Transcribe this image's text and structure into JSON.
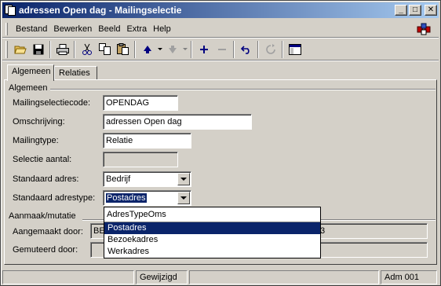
{
  "window": {
    "title": "adressen Open dag - Mailingselectie",
    "min_label": "_",
    "max_label": "□",
    "close_label": "✕"
  },
  "menu": {
    "items": [
      {
        "label": "Bestand"
      },
      {
        "label": "Bewerken"
      },
      {
        "label": "Beeld"
      },
      {
        "label": "Extra"
      },
      {
        "label": "Help"
      }
    ]
  },
  "toolbar": {
    "buttons": [
      {
        "icon": "open-folder-icon"
      },
      {
        "icon": "save-icon"
      },
      {
        "icon": "print-icon"
      },
      {
        "icon": "cut-icon"
      },
      {
        "icon": "copy-icon"
      },
      {
        "icon": "paste-icon"
      },
      {
        "icon": "arrow-up-icon"
      },
      {
        "icon": "arrow-down-icon"
      },
      {
        "icon": "add-icon"
      },
      {
        "icon": "remove-icon"
      },
      {
        "icon": "undo-icon"
      },
      {
        "icon": "refresh-icon"
      },
      {
        "icon": "window-icon"
      }
    ]
  },
  "tabs": [
    {
      "label": "Algemeen",
      "active": true
    },
    {
      "label": "Relaties",
      "active": false
    }
  ],
  "form": {
    "group_general": "Algemeen",
    "code_label": "Mailingselectiecode:",
    "code_value": "OPENDAG",
    "description_label": "Omschrijving:",
    "description_value": "adressen Open dag",
    "type_label": "Mailingtype:",
    "type_value": "Relatie",
    "count_label": "Selectie aantal:",
    "count_value": "",
    "std_address_label": "Standaard adres:",
    "std_address_value": "Bedrijf",
    "std_addresstype_label": "Standaard adrestype:",
    "std_addresstype_value": "Postadres",
    "group_audit": "Aanmaak/mutatie",
    "created_label": "Aangemaakt door:",
    "created_value_prefix": "BE",
    "created_value_suffix": "3",
    "modified_label": "Gemuteerd door:"
  },
  "dropdown": {
    "header": "AdresTypeOms",
    "options": [
      "Postadres",
      "Bezoekadres",
      "Werkadres"
    ],
    "selected": "Postadres"
  },
  "statusbar": {
    "cell1": "",
    "status": "Gewijzigd",
    "cell3": "",
    "user": "Adm 001"
  },
  "colors": {
    "title_active": "#0a246a",
    "face": "#d4d0c8",
    "selection": "#0a246a"
  }
}
